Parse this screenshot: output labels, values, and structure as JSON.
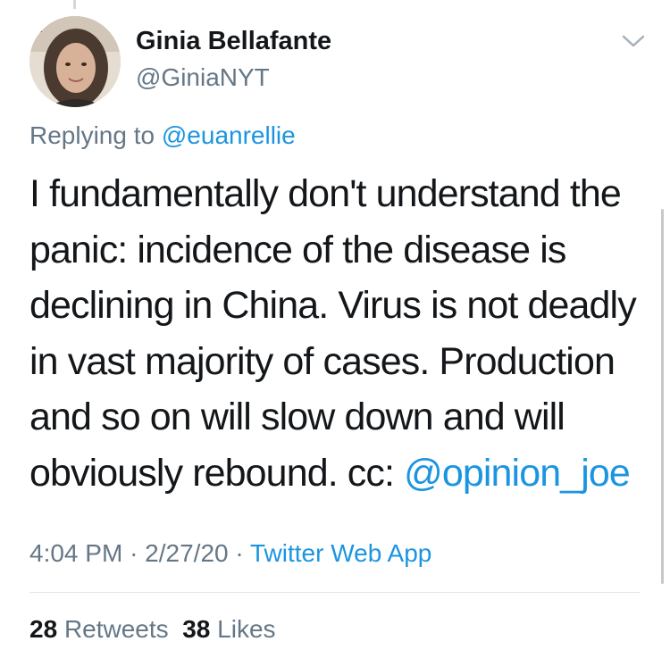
{
  "author": {
    "display_name": "Ginia Bellafante",
    "handle": "@GiniaNYT",
    "avatar_icon": "profile-photo-avatar"
  },
  "reply": {
    "prefix": "Replying to",
    "mention": "@euanrellie"
  },
  "tweet": {
    "text": "I fundamentally don't understand the panic: incidence of the disease is declining in China. Virus is not deadly in vast majority of cases. Production and so on will slow down and will obviously rebound. cc:",
    "mention": "@opinion_joe"
  },
  "meta": {
    "time": "4:04 PM",
    "separator": "·",
    "date": "2/27/20",
    "source": "Twitter Web App"
  },
  "stats": {
    "retweets_count": "28",
    "retweets_label": "Retweets",
    "likes_count": "38",
    "likes_label": "Likes"
  },
  "icons": {
    "more_menu": "chevron-down-icon"
  },
  "colors": {
    "text": "#14171a",
    "secondary": "#657786",
    "link": "#1b95e0",
    "divider": "#e1e8ed"
  }
}
